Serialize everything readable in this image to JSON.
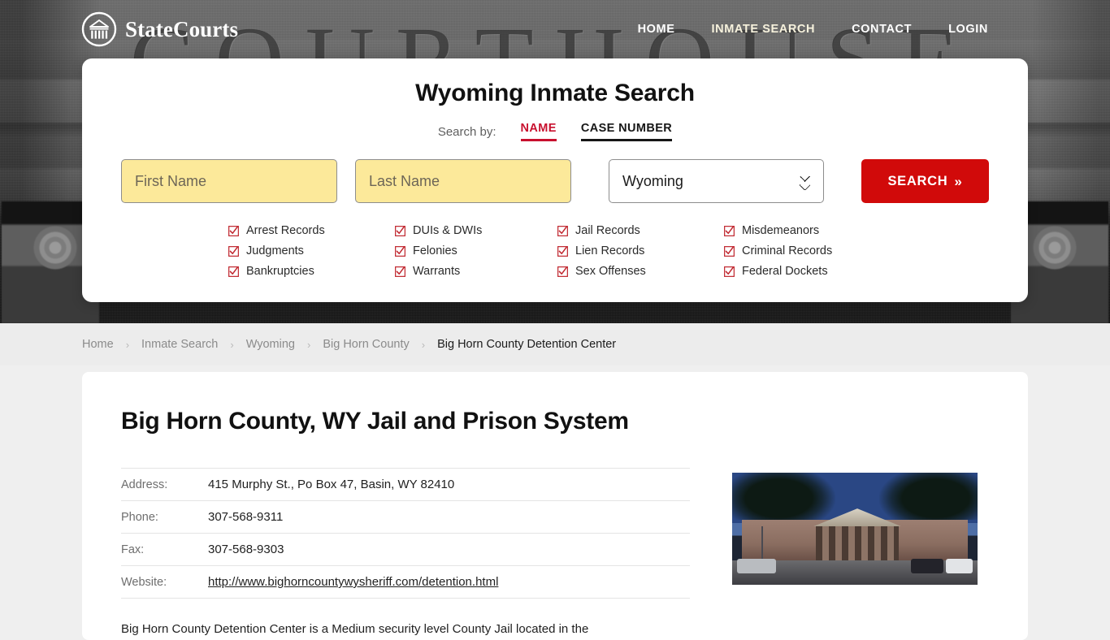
{
  "site": {
    "brand_name": "StateCourts",
    "logo_icon": "courthouse-circle-icon"
  },
  "nav": {
    "items": [
      {
        "label": "HOME",
        "accent": false
      },
      {
        "label": "INMATE SEARCH",
        "accent": true
      },
      {
        "label": "CONTACT",
        "accent": false
      },
      {
        "label": "LOGIN",
        "accent": false
      }
    ]
  },
  "hero": {
    "background_word": "COURTHOUSE",
    "background_style": "grayscale-courthouse-photo"
  },
  "search_card": {
    "title": "Wyoming Inmate Search",
    "search_by_label": "Search by:",
    "tabs": [
      {
        "label": "NAME",
        "active": true
      },
      {
        "label": "CASE NUMBER",
        "active": false
      }
    ],
    "first_name": {
      "placeholder": "First Name",
      "value": ""
    },
    "last_name": {
      "placeholder": "Last Name",
      "value": ""
    },
    "state": {
      "selected": "Wyoming"
    },
    "submit": {
      "label": "SEARCH",
      "icon": "double-chevron-right-icon"
    },
    "categories": [
      "Arrest Records",
      "DUIs & DWIs",
      "Jail Records",
      "Misdemeanors",
      "Judgments",
      "Felonies",
      "Lien Records",
      "Criminal Records",
      "Bankruptcies",
      "Warrants",
      "Sex Offenses",
      "Federal Dockets"
    ],
    "colors": {
      "accent_red": "#c8102e",
      "button_red": "#d10a0a",
      "field_yellow": "#fce99a",
      "checkbox_red": "#c0262e"
    }
  },
  "breadcrumb": {
    "separator": "›",
    "items": [
      {
        "label": "Home",
        "current": false
      },
      {
        "label": "Inmate Search",
        "current": false
      },
      {
        "label": "Wyoming",
        "current": false
      },
      {
        "label": "Big Horn County",
        "current": false
      },
      {
        "label": "Big Horn County Detention Center",
        "current": true
      }
    ]
  },
  "content": {
    "page_title": "Big Horn County, WY Jail and Prison System",
    "info_rows": [
      {
        "label": "Address:",
        "value": "415 Murphy St., Po Box 47, Basin, WY 82410",
        "is_link": false
      },
      {
        "label": "Phone:",
        "value": "307-568-9311",
        "is_link": false
      },
      {
        "label": "Fax:",
        "value": "307-568-9303",
        "is_link": false
      },
      {
        "label": "Website:",
        "value": "http://www.bighorncountywysheriff.com/detention.html",
        "is_link": true
      }
    ],
    "photo_alt": "Big Horn County Detention Center building exterior",
    "description": "Big Horn County Detention Center is a Medium security level County Jail located in the"
  }
}
